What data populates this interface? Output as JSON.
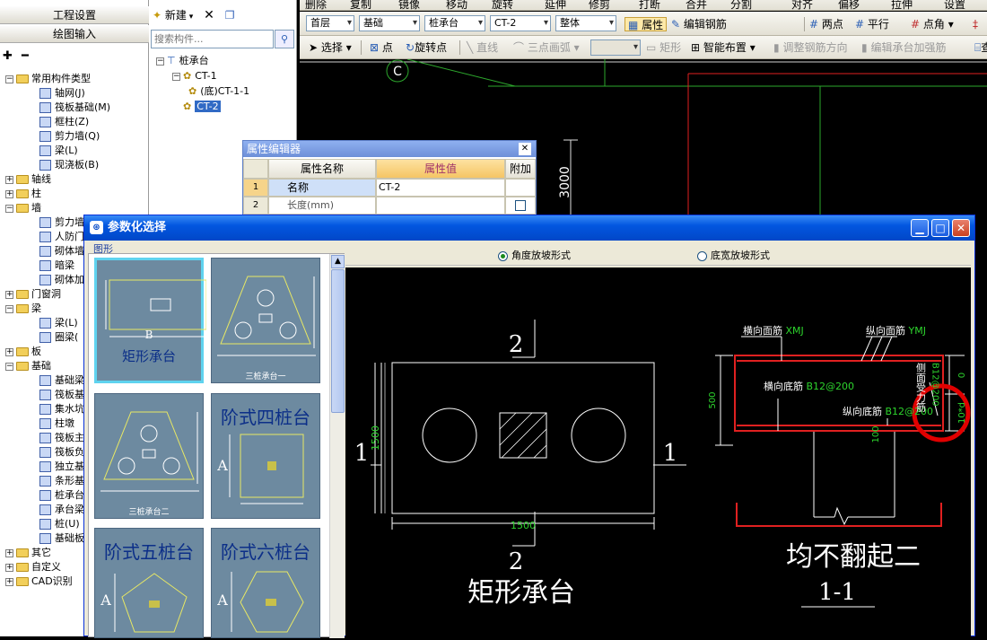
{
  "leftnav": {
    "btn1": "工程设置",
    "btn2": "绘图输入",
    "tree": [
      {
        "label": "常用构件类型",
        "level": 0,
        "open": true,
        "folder": true
      },
      {
        "label": "轴网(J)",
        "level": 1
      },
      {
        "label": "筏板基础(M)",
        "level": 1
      },
      {
        "label": "框柱(Z)",
        "level": 1
      },
      {
        "label": "剪力墙(Q)",
        "level": 1
      },
      {
        "label": "梁(L)",
        "level": 1
      },
      {
        "label": "现浇板(B)",
        "level": 1
      },
      {
        "label": "轴线",
        "level": 0,
        "open": false,
        "folder": true
      },
      {
        "label": "柱",
        "level": 0,
        "open": false,
        "folder": true
      },
      {
        "label": "墙",
        "level": 0,
        "open": true,
        "folder": true
      },
      {
        "label": "剪力墙",
        "level": 1
      },
      {
        "label": "人防门",
        "level": 1
      },
      {
        "label": "砌体墙",
        "level": 1
      },
      {
        "label": "暗梁",
        "level": 1
      },
      {
        "label": "砌体加",
        "level": 1
      },
      {
        "label": "门窗洞",
        "level": 0,
        "open": false,
        "folder": true
      },
      {
        "label": "梁",
        "level": 0,
        "open": true,
        "folder": true
      },
      {
        "label": "梁(L)",
        "level": 1
      },
      {
        "label": "圈梁(",
        "level": 1
      },
      {
        "label": "板",
        "level": 0,
        "open": false,
        "folder": true
      },
      {
        "label": "基础",
        "level": 0,
        "open": true,
        "folder": true
      },
      {
        "label": "基础梁",
        "level": 1
      },
      {
        "label": "筏板基",
        "level": 1
      },
      {
        "label": "集水坑",
        "level": 1
      },
      {
        "label": "柱墩",
        "level": 1
      },
      {
        "label": "筏板主",
        "level": 1
      },
      {
        "label": "筏板负",
        "level": 1
      },
      {
        "label": "独立基",
        "level": 1
      },
      {
        "label": "条形基",
        "level": 1
      },
      {
        "label": "桩承台",
        "level": 1
      },
      {
        "label": "承台梁",
        "level": 1
      },
      {
        "label": "桩(U)",
        "level": 1
      },
      {
        "label": "基础板",
        "level": 1
      },
      {
        "label": "其它",
        "level": 0,
        "open": false,
        "folder": true
      },
      {
        "label": "自定义",
        "level": 0,
        "open": false,
        "folder": true
      },
      {
        "label": "CAD识别",
        "level": 0,
        "open": false,
        "folder": true
      }
    ]
  },
  "comp": {
    "new_label": "新建",
    "search_placeholder": "搜索构件...",
    "tree": [
      {
        "label": "桩承台",
        "level": 0
      },
      {
        "label": "CT-1",
        "level": 1
      },
      {
        "label": "(底)CT-1-1",
        "level": 2
      },
      {
        "label": "CT-2",
        "level": 1,
        "selected": true
      }
    ]
  },
  "toolbar1": {
    "items": [
      "删除",
      "复制",
      "镜像",
      "移动",
      "旋转",
      "延伸",
      "修剪",
      "打断",
      "合并",
      "分割",
      "对齐",
      "偏移",
      "拉伸",
      "设置"
    ]
  },
  "toolbar2": {
    "floor": "首层",
    "category": "基础",
    "type": "桩承台",
    "name": "CT-2",
    "unit": "整体",
    "attr_btn": "属性",
    "edit_rebar": "编辑钢筋",
    "two_point": "两点",
    "parallel": "平行",
    "point_angle": "点角"
  },
  "toolbar3": {
    "select": "选择",
    "point": "点",
    "rotate_point": "旋转点",
    "line": "直线",
    "arc": "三点画弧",
    "rect": "矩形",
    "smart": "智能布置",
    "adjust": "调整钢筋方向",
    "edit_cap": "编辑承台加强筋",
    "check": "查"
  },
  "cad": {
    "label_c": "C",
    "dim": "3000"
  },
  "prop_editor": {
    "title": "属性编辑器",
    "headers": [
      "属性名称",
      "属性值",
      "附加"
    ],
    "rows": [
      {
        "no": "1",
        "name": "名称",
        "value": "CT-2"
      },
      {
        "no": "2",
        "name": "长度(mm)",
        "value": ""
      }
    ]
  },
  "dialog": {
    "title": "参数化选择",
    "group_label": "图形",
    "options": [
      {
        "label": "角度放坡形式",
        "checked": true
      },
      {
        "label": "底宽放坡形式",
        "checked": false
      }
    ],
    "thumbs": [
      {
        "label": "矩形承台",
        "sub": "B"
      },
      {
        "label": "三桩承台一",
        "sub": ""
      },
      {
        "label": "三桩承台二",
        "sub": ""
      },
      {
        "label": "阶式四桩台",
        "sub": "A"
      },
      {
        "label": "阶式五桩台",
        "sub": "A"
      },
      {
        "label": "阶式六桩台",
        "sub": "A"
      }
    ],
    "preview": {
      "sec2": "2",
      "sec1": "1",
      "dim_w": "1500",
      "dim_h": "1500",
      "title": "矩形承台",
      "lbl_xmj": "横向面筋",
      "val_xmj": "XMJ",
      "lbl_ymj": "纵向面筋",
      "val_ymj": "YMJ",
      "lbl_xdj": "横向底筋",
      "val_xdj": "B12@200",
      "lbl_ydj": "纵向底筋",
      "val_ydj": "B12@200",
      "lbl_side": "侧面受力筋",
      "val_side": "B12@200",
      "dim_500": "500",
      "dim_100": "100",
      "dim_10d": "10*d",
      "dim_0": "0",
      "section_title": "均不翻起二",
      "section_id": "1-1"
    }
  }
}
